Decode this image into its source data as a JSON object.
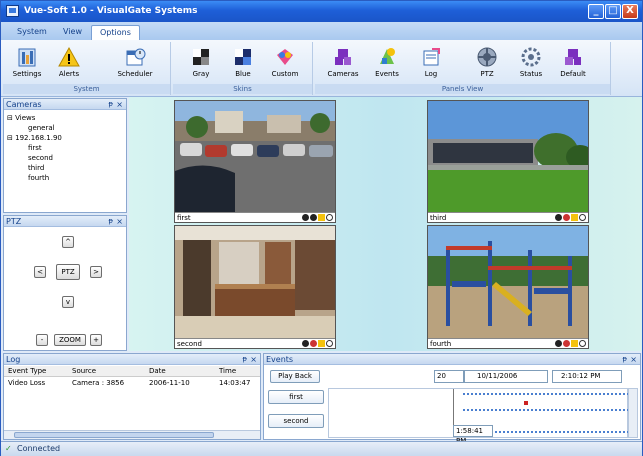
{
  "window": {
    "title": "Vue-Soft 1.0 - VisualGate Systems",
    "minimize": "_",
    "maximize": "□",
    "close": "X"
  },
  "menu": {
    "tabs": [
      {
        "label": "System"
      },
      {
        "label": "View"
      },
      {
        "label": "Options"
      }
    ],
    "active": "Options"
  },
  "ribbon": {
    "groups": [
      {
        "label": "System",
        "buttons": [
          {
            "label": "Settings",
            "icon": "settings-icon"
          },
          {
            "label": "Alerts",
            "icon": "alert-icon"
          },
          {
            "label": "Scheduler",
            "icon": "scheduler-icon"
          }
        ]
      },
      {
        "label": "Skins",
        "buttons": [
          {
            "label": "Gray",
            "icon": "gray-skin-icon"
          },
          {
            "label": "Blue",
            "icon": "blue-skin-icon"
          },
          {
            "label": "Custom",
            "icon": "custom-skin-icon"
          }
        ]
      },
      {
        "label": "Panels View",
        "buttons": [
          {
            "label": "Cameras",
            "icon": "cameras-panel-icon"
          },
          {
            "label": "Events",
            "icon": "events-panel-icon"
          },
          {
            "label": "Log",
            "icon": "log-panel-icon"
          },
          {
            "label": "PTZ",
            "icon": "ptz-panel-icon"
          },
          {
            "label": "Status",
            "icon": "status-panel-icon"
          },
          {
            "label": "Default",
            "icon": "default-panel-icon"
          }
        ]
      }
    ]
  },
  "cameras_pane": {
    "title": "Cameras",
    "pin": "ᵽ",
    "close": "×",
    "tree": [
      {
        "label": "Views",
        "toggle": "⊟"
      },
      {
        "label": "general"
      },
      {
        "label": "192.168.1.90",
        "toggle": "⊟"
      },
      {
        "label": "first"
      },
      {
        "label": "second"
      },
      {
        "label": "third"
      },
      {
        "label": "fourth"
      }
    ]
  },
  "ptz_pane": {
    "title": "PTZ",
    "pin": "ᵽ",
    "close": "×",
    "up": "^",
    "down": "v",
    "left": "<",
    "right": ">",
    "center": "PTZ",
    "zoom_out": "-",
    "zoom": "ZOOM",
    "zoom_in": "+"
  },
  "viewer": {
    "cameras": [
      {
        "name": "first"
      },
      {
        "name": "third"
      },
      {
        "name": "second"
      },
      {
        "name": "fourth"
      }
    ],
    "control_colors": [
      "#222222",
      "#cc3333",
      "#f4c20d",
      "#3a7ae0"
    ]
  },
  "log_pane": {
    "title": "Log",
    "pin": "ᵽ",
    "close": "×",
    "columns": [
      "Event Type",
      "Source",
      "Date",
      "Time"
    ],
    "rows": [
      [
        "Video Loss",
        "Camera : 3856",
        "2006-11-10",
        "14:03:47"
      ]
    ]
  },
  "events_pane": {
    "title": "Events",
    "pin": "ᵽ",
    "close": "×",
    "playback_label": "Play Back",
    "count": "20",
    "date": "10/11/2006",
    "time": "2:10:12 PM",
    "cameras": [
      "first",
      "second"
    ],
    "timeline_cursor": "1:58:41 PM"
  },
  "status": {
    "text": "Connected"
  }
}
